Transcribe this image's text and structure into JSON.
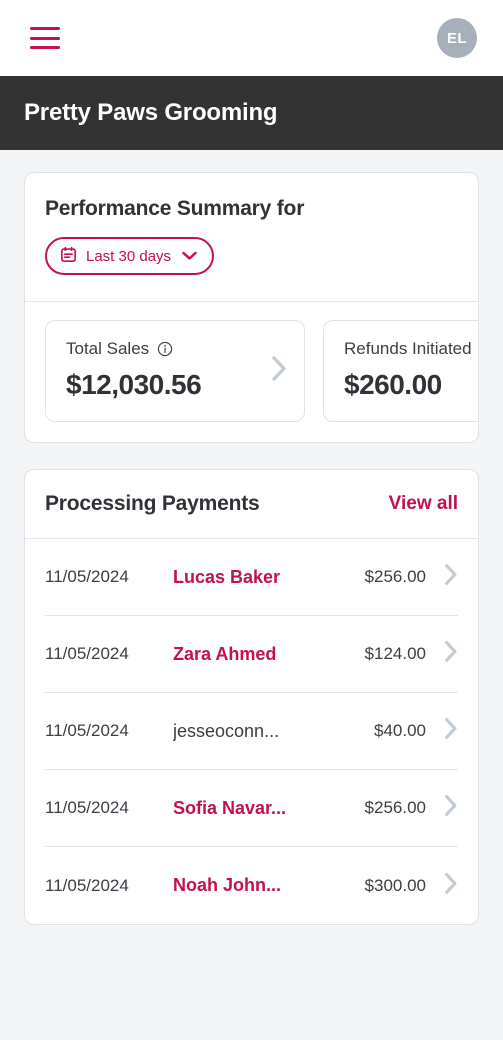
{
  "appbar": {
    "menu_icon": "hamburger-menu-icon",
    "avatar_initials": "EL"
  },
  "titlebar": {
    "business_name": "Pretty Paws Grooming"
  },
  "colors": {
    "brand_crimson": "#C2114B",
    "dark_bar": "#333333",
    "page_background": "#F4F5F6",
    "avatar_gray": "#A7B0BA",
    "chevron_gray": "#C3CBD3"
  },
  "performance": {
    "heading": "Performance Summary for",
    "date_filter": {
      "label": "Last 30 days",
      "calendar_icon": "calendar-icon",
      "chevron_icon": "chevron-down-icon"
    },
    "stats": [
      {
        "label": "Total Sales",
        "value": "$12,030.56",
        "info_icon": "info-icon",
        "has_info": true
      },
      {
        "label": "Refunds Initiated",
        "value": "$260.00",
        "has_info": false
      }
    ]
  },
  "payments": {
    "heading": "Processing Payments",
    "view_all_label": "View all",
    "rows": [
      {
        "date": "11/05/2024",
        "name": "Lucas Baker",
        "amount": "$256.00",
        "linked": true
      },
      {
        "date": "11/05/2024",
        "name": "Zara Ahmed",
        "amount": "$124.00",
        "linked": true
      },
      {
        "date": "11/05/2024",
        "name": "jesseoconn...",
        "amount": "$40.00",
        "linked": false
      },
      {
        "date": "11/05/2024",
        "name": "Sofia Navar...",
        "amount": "$256.00",
        "linked": true
      },
      {
        "date": "11/05/2024",
        "name": "Noah John...",
        "amount": "$300.00",
        "linked": true
      }
    ]
  }
}
